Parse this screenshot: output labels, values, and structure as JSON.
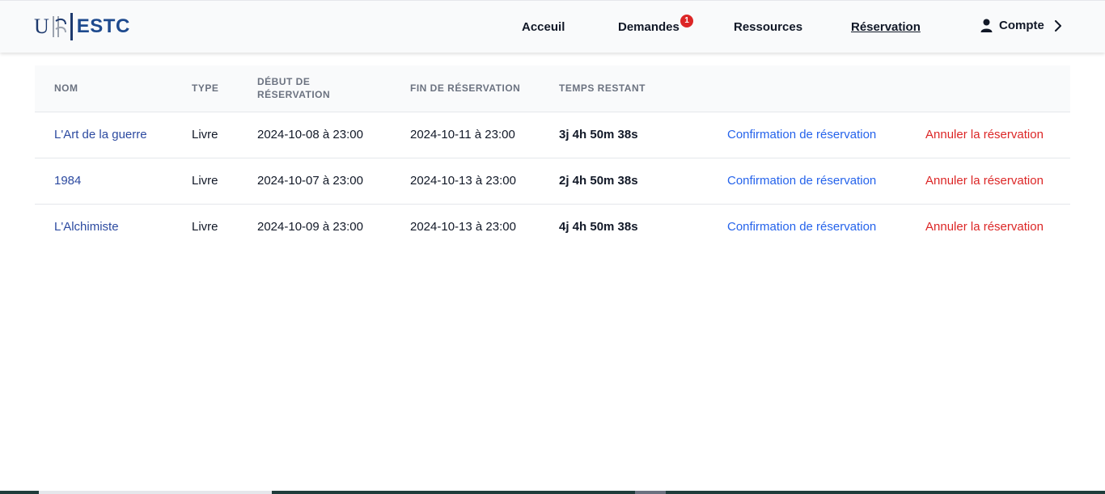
{
  "brand": {
    "name": "ESTC",
    "initial": "U"
  },
  "nav": {
    "items": [
      {
        "label": "Acceuil"
      },
      {
        "label": "Demandes",
        "badge": "1"
      },
      {
        "label": "Ressources"
      },
      {
        "label": "Réservation",
        "active": true
      }
    ],
    "account": {
      "label": "Compte"
    }
  },
  "table": {
    "headers": [
      "Nom",
      "Type",
      "Début de réservation",
      "Fin de réservation",
      "Temps restant"
    ],
    "rows": [
      {
        "name": "L'Art de la guerre",
        "type": "Livre",
        "start": "2024-10-08 à 23:00",
        "end": "2024-10-11 à 23:00",
        "remaining": "3j 4h 50m 38s",
        "confirm": "Confirmation de réservation",
        "cancel": "Annuler la réservation"
      },
      {
        "name": "1984",
        "type": "Livre",
        "start": "2024-10-07 à 23:00",
        "end": "2024-10-13 à 23:00",
        "remaining": "2j 4h 50m 38s",
        "confirm": "Confirmation de réservation",
        "cancel": "Annuler la réservation"
      },
      {
        "name": "L'Alchimiste",
        "type": "Livre",
        "start": "2024-10-09 à 23:00",
        "end": "2024-10-13 à 23:00",
        "remaining": "4j 4h 50m 38s",
        "confirm": "Confirmation de réservation",
        "cancel": "Annuler la réservation"
      }
    ]
  },
  "colors": {
    "link": "#2c4aa0",
    "confirm": "#2563eb",
    "cancel": "#dc2626",
    "badge": "#dc2626",
    "brand": "#1e3a6e"
  },
  "icons": {
    "account": "user-icon",
    "account_chevron": "chevron-right-icon"
  }
}
